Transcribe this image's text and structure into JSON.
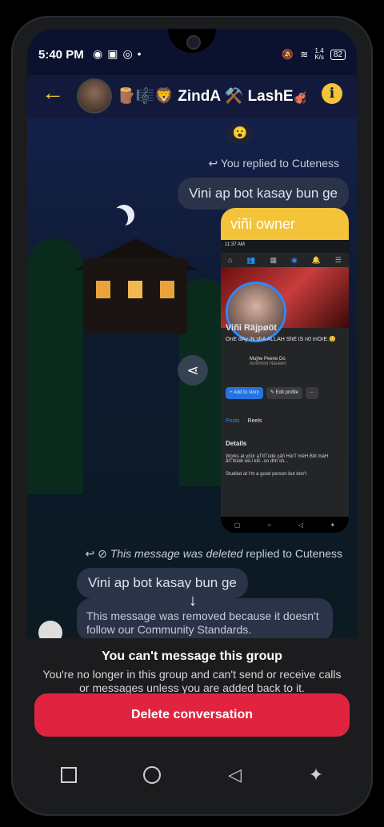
{
  "status": {
    "time": "5:40 PM",
    "net_speed_top": "1.4",
    "net_speed_unit": "K/s",
    "battery": "82"
  },
  "header": {
    "title": "🪵🎼🦁 ZindA ⚒️ LashE🎻"
  },
  "messages": {
    "reaction": "😮",
    "replied_label": "You replied to Cuteness",
    "outgoing_text": "Vini ap bot kasay bun ge",
    "image_caption": "viñi owner",
    "deleted_label_prefix": "This message",
    "deleted_label_mid": "was deleted",
    "deleted_label_suffix": "replied to Cuteness",
    "incoming_text": "Vini ap bot kasay bun ge",
    "removed_text": "This message was removed because it doesn't follow our Community Standards."
  },
  "fb_screenshot": {
    "status_time": "11:37 AM",
    "name": "Viñi Räjpøöt",
    "bio": "OnE dAy iN shA ALLAH ShE iS n0 mOrE.😊",
    "song_title": "Mujhe Peene Do",
    "song_artist": "Arshmini Naveen",
    "add_story": "+ Add to story",
    "edit_profile": "✎ Edit profile",
    "more": "···",
    "tab_posts": "Posts",
    "tab_reels": "Reels",
    "details": "Details",
    "detail_1": "Works at yöür aTtITüdè çäñ HürT mèH Bût màH åtTItüdè wiLl kill...so dNt sh...",
    "detail_2": "Studied at I'm a good person but don't"
  },
  "footer": {
    "title": "You can't message this group",
    "subtitle": "You're no longer in this group and can't send or receive calls or messages unless you are added back to it.",
    "delete_label": "Delete conversation"
  }
}
